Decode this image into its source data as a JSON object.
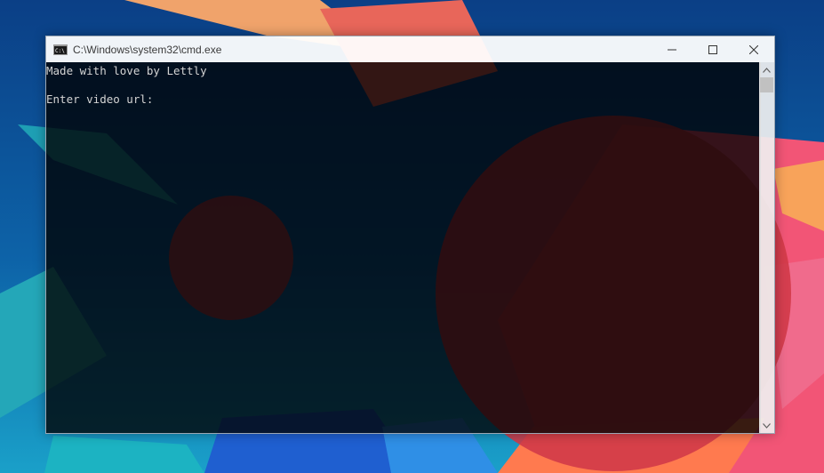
{
  "window": {
    "title": "C:\\Windows\\system32\\cmd.exe",
    "icon": "cmd-icon"
  },
  "console": {
    "lines": [
      "Made with love by Lettly",
      "Enter video url: "
    ]
  },
  "controls": {
    "minimize_icon": "minimize-icon",
    "maximize_icon": "maximize-icon",
    "close_icon": "close-icon"
  },
  "colors": {
    "console_text": "#d4d4d4",
    "console_bg": "#000000",
    "titlebar_bg": "#ffffff"
  }
}
